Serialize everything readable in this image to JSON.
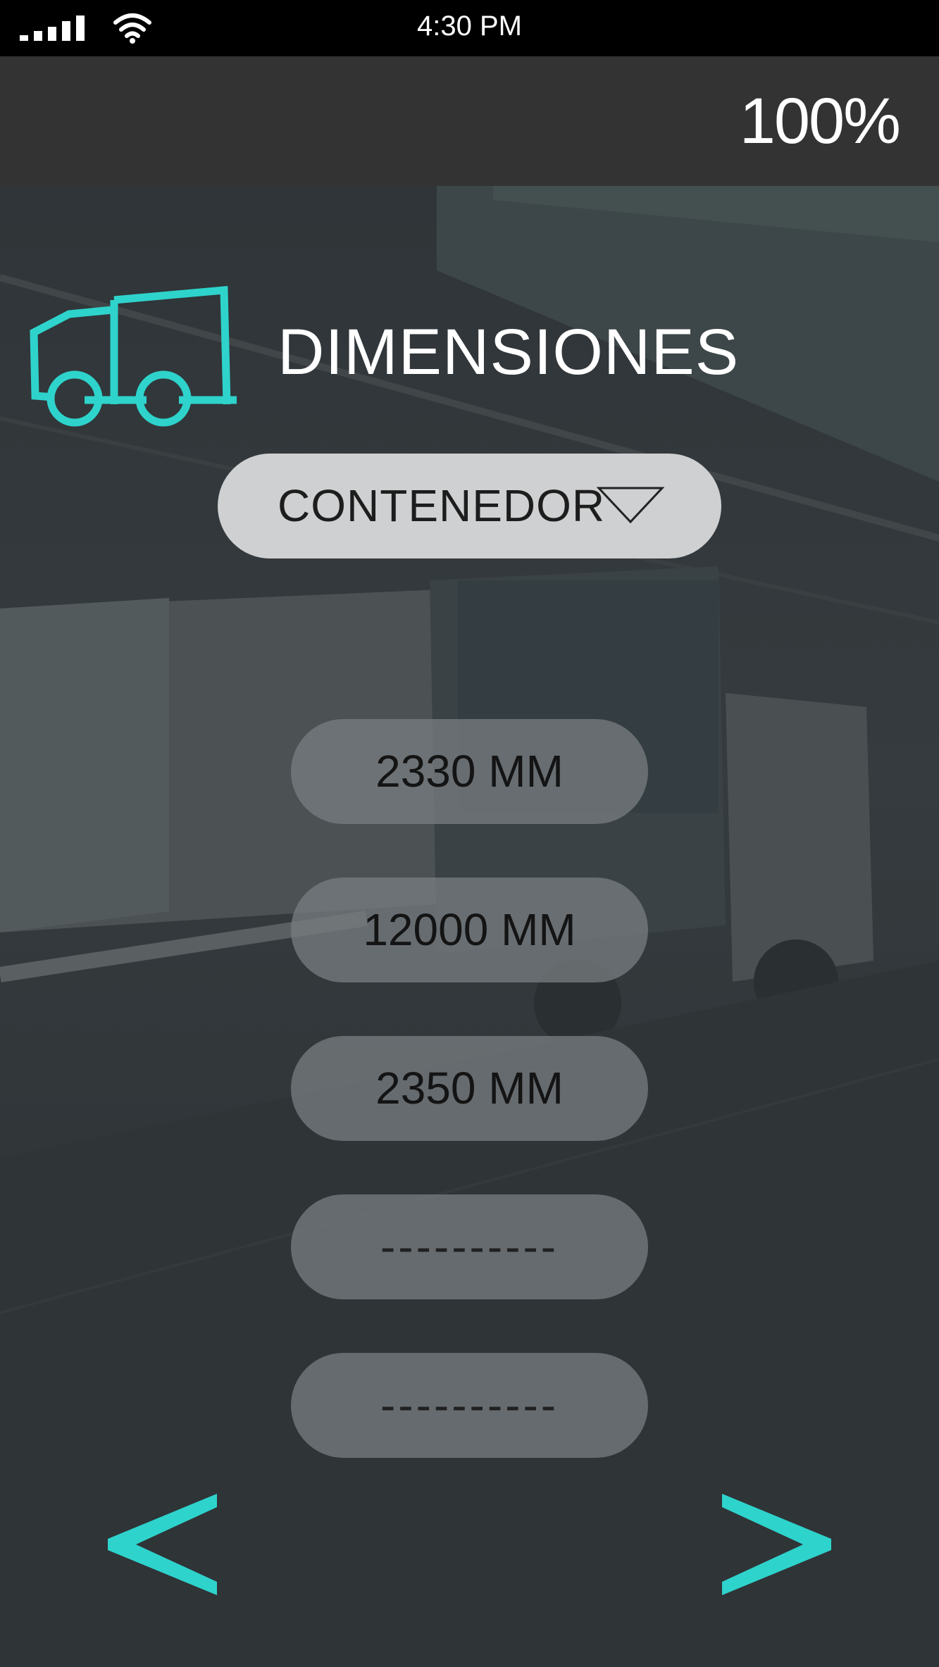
{
  "status_bar": {
    "time": "4:30 PM",
    "signal_icon": "cellular-signal-icon",
    "wifi_icon": "wifi-icon"
  },
  "header": {
    "battery_level": "100%"
  },
  "section": {
    "title": "DIMENSIONES",
    "icon": "truck-icon"
  },
  "dropdown": {
    "selected": "CONTENEDOR",
    "icon": "caret-down-icon"
  },
  "values": [
    "2330 MM",
    "12000 MM",
    "2350 MM",
    "----------",
    "----------"
  ],
  "navigation": {
    "prev_label": "<",
    "next_label": ">"
  },
  "colors": {
    "accent": "#2ed3cc",
    "header_bg": "#333333",
    "status_bg": "#000000",
    "dropdown_bg": "#cfd0d1"
  }
}
